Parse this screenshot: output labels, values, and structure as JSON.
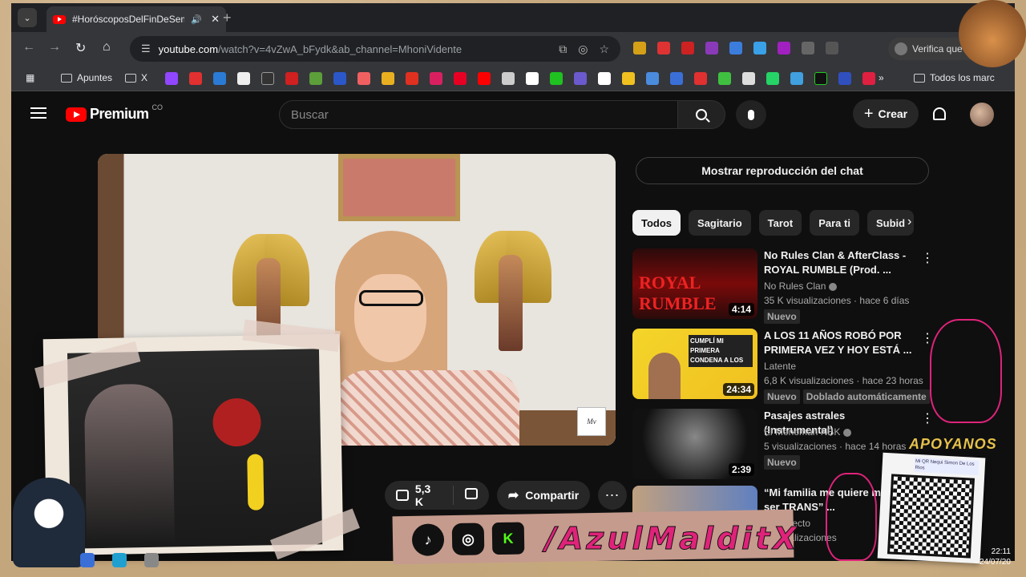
{
  "browser": {
    "tab_title": "#HoróscoposDelFinDeSema",
    "url_host": "youtube.com",
    "url_path": "/watch?v=4vZwA_bFydk&ab_channel=MhoniVidente",
    "profile_text": "Verifica que",
    "bookmarks": {
      "apuntes": "Apuntes",
      "x": "X",
      "todos": "Todos los marc"
    }
  },
  "youtube": {
    "logo": "Premium",
    "logo_sup": "CO",
    "search_placeholder": "Buscar",
    "create_label": "Crear",
    "likes": "5,3 K",
    "share_label": "Compartir",
    "chat_button": "Mostrar reproducción del chat",
    "chips": [
      "Todos",
      "Sagitario",
      "Tarot",
      "Para ti",
      "Subid"
    ],
    "videos": [
      {
        "title": "No Rules Clan  & AfterClass - ROYAL RUMBLE (Prod. ...",
        "channel": "No Rules Clan",
        "meta": "35 K visualizaciones · hace 6 días",
        "duration": "4:14",
        "badges": [
          "Nuevo"
        ],
        "thumb_text": "ROYAL RUMBLE"
      },
      {
        "title": "A LOS 11 AÑOS ROBÓ POR PRIMERA VEZ Y HOY ESTÁ ...",
        "channel": "Latente",
        "meta": "6,8 K visualizaciones · hace 23 horas",
        "duration": "24:34",
        "badges": [
          "Nuevo",
          "Doblado automáticamente"
        ],
        "thumb_text": "CUMPLÍ MI PRIMERA CONDENA A LOS"
      },
      {
        "title": "Pasajes astrales (Instrumental)",
        "channel": "El Monoman NBK",
        "meta": "5 visualizaciones · hace 14 horas",
        "duration": "2:39",
        "badges": [
          "Nuevo"
        ],
        "thumb_text": ""
      },
      {
        "title": "“Mi familia me quiere m... por ser TRANS” ...",
        "channel": "...o Directo",
        "meta": "...visualizaciones",
        "duration": "",
        "badges": [],
        "thumb_text": ""
      }
    ]
  },
  "overlay": {
    "handle": "/AzulMalditX",
    "apoyanos": "APOYANOS",
    "qr_label": "Mi QR Nequi Simon De Los Rios",
    "watermark": "Mv",
    "clock_time": "22:11",
    "clock_date": "24/07/20"
  },
  "colors": {
    "youtube_red": "#ff0000",
    "accent_pink": "#e0237a",
    "bg": "#0f0f0f"
  }
}
